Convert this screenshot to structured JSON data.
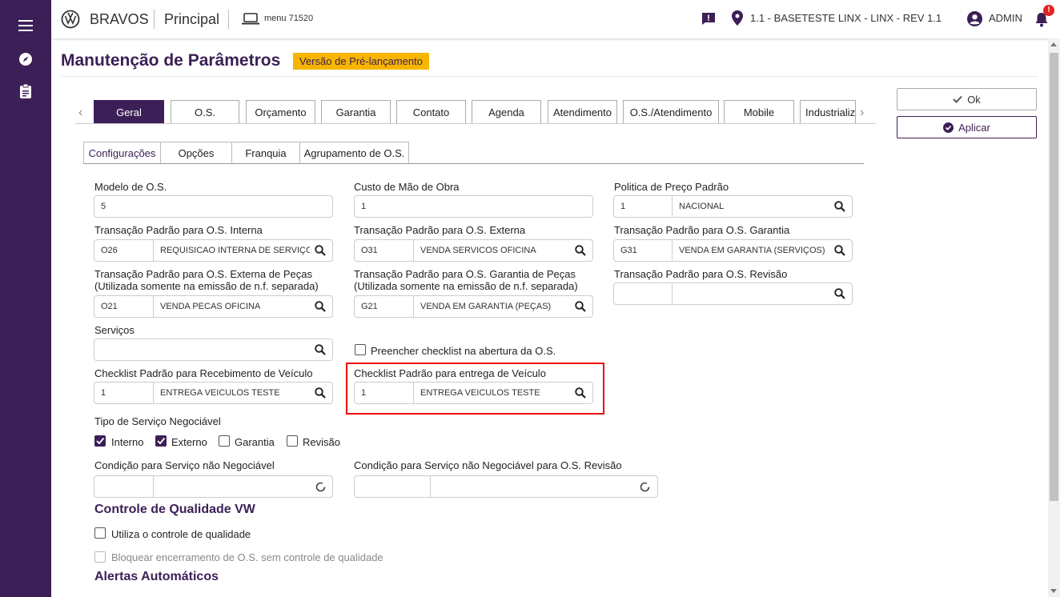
{
  "header": {
    "brand": "BRAVOS",
    "module": "Principal",
    "menu_code": "menu 71520",
    "location": "1.1 - BASETESTE LINX - LINX - REV 1.1",
    "user": "ADMIN",
    "notification_badge": "!"
  },
  "page": {
    "title": "Manutenção de Parâmetros",
    "badge": "Versão de Pré-lançamento"
  },
  "actions": {
    "ok": "Ok",
    "apply": "Aplicar"
  },
  "main_tabs": [
    "Geral",
    "O.S.",
    "Orçamento",
    "Garantia",
    "Contato",
    "Agenda",
    "Atendimento",
    "O.S./Atendimento",
    "Mobile",
    "Industrializ"
  ],
  "sub_tabs": [
    "Configurações",
    "Opções",
    "Franquia",
    "Agrupamento de O.S."
  ],
  "fields": {
    "modelo_os": {
      "label": "Modelo de O.S.",
      "value": "5"
    },
    "custo_mao_obra": {
      "label": "Custo de Mão de Obra",
      "value": "1"
    },
    "politica_preco": {
      "label": "Politica de Preço Padrão",
      "code": "1",
      "desc": "NACIONAL"
    },
    "trans_interna": {
      "label": "Transação Padrão para O.S. Interna",
      "code": "O26",
      "desc": "REQUISICAO INTERNA DE SERVIÇO -"
    },
    "trans_externa": {
      "label": "Transação Padrão para O.S. Externa",
      "code": "O31",
      "desc": "VENDA SERVICOS OFICINA"
    },
    "trans_garantia": {
      "label": "Transação Padrão para O.S. Garantia",
      "code": "G31",
      "desc": "VENDA EM GARANTIA (SERVIÇOS)"
    },
    "trans_ext_pecas": {
      "label": "Transação Padrão para O.S. Externa de Peças",
      "label2": "(Utilizada somente na emissão de n.f. separada)",
      "code": "O21",
      "desc": "VENDA PECAS OFICINA"
    },
    "trans_gar_pecas": {
      "label": "Transação Padrão para O.S. Garantia de Peças",
      "label2": "(Utilizada somente na emissão de n.f. separada)",
      "code": "G21",
      "desc": "VENDA EM GARANTIA (PEÇAS)"
    },
    "trans_revisao": {
      "label": "Transação Padrão para O.S. Revisão",
      "code": "",
      "desc": ""
    },
    "servicos": {
      "label": "Serviços",
      "value": ""
    },
    "preencher_checklist": {
      "label": "Preencher checklist na abertura da O.S."
    },
    "checklist_receb": {
      "label": "Checklist Padrão para Recebimento de Veículo",
      "code": "1",
      "desc": "ENTREGA VEICULOS TESTE"
    },
    "checklist_entrega": {
      "label": "Checklist Padrão para entrega de Veículo",
      "code": "1",
      "desc": "ENTREGA VEICULOS TESTE"
    },
    "tipo_servico": {
      "label": "Tipo de Serviço Negociável",
      "options": [
        {
          "label": "Interno",
          "checked": true
        },
        {
          "label": "Externo",
          "checked": true
        },
        {
          "label": "Garantia",
          "checked": false
        },
        {
          "label": "Revisão",
          "checked": false
        }
      ]
    },
    "cond_nao_neg": {
      "label": "Condição para Serviço não Negociável"
    },
    "cond_nao_neg_rev": {
      "label": "Condição para Serviço não Negociável para O.S. Revisão"
    }
  },
  "qualidade": {
    "title": "Controle de Qualidade VW",
    "usa_controle": "Utiliza o controle de qualidade",
    "bloquear": "Bloquear encerramento de O.S. sem controle de qualidade"
  },
  "alertas": {
    "title": "Alertas Automáticos"
  }
}
